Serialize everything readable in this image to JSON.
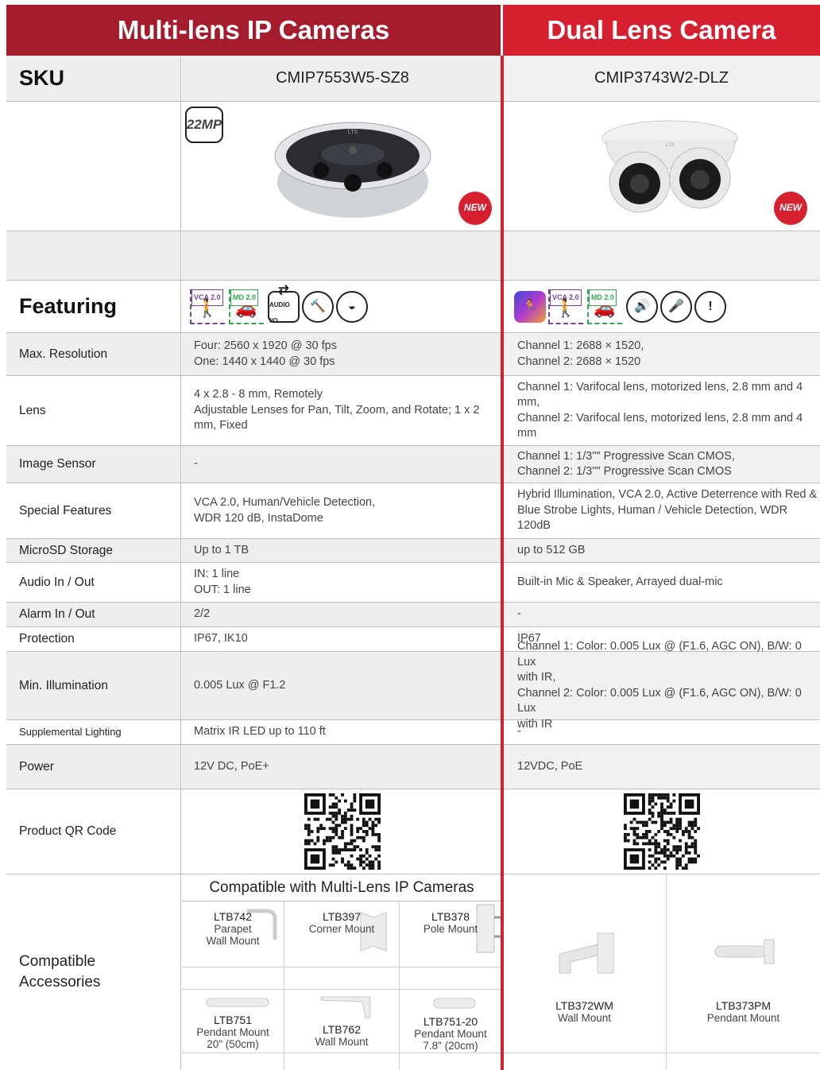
{
  "header": {
    "left_title": "Multi-lens IP Cameras",
    "right_title": "Dual Lens Camera"
  },
  "colors": {
    "dark_red": "#a51c2c",
    "bright_red": "#d6202f"
  },
  "sku_row": {
    "label": "SKU",
    "left": "CMIP7553W5-SZ8",
    "right": "CMIP3743W2-DLZ"
  },
  "image_row": {
    "badge_left": "22MP",
    "new_badge": "NEW"
  },
  "featuring": {
    "label": "Featuring",
    "vca": "VCA 2.0",
    "md": "MD 2.0",
    "audio_io": "AUDIO I/O"
  },
  "specs": [
    {
      "label": "Max. Resolution",
      "left": "Four: 2560 x 1920 @ 30 fps\nOne: 1440 x 1440 @ 30 fps",
      "right": "Channel 1: 2688 × 1520,\nChannel 2: 2688 × 1520"
    },
    {
      "label": "Lens",
      "left": "4 x 2.8 - 8 mm, Remotely\nAdjustable Lenses for Pan, Tilt, Zoom, and Rotate; 1 x 2\nmm, Fixed",
      "right": "Channel 1: Varifocal lens, motorized lens, 2.8 mm and 4 mm,\nChannel 2: Varifocal lens, motorized lens, 2.8 mm and 4 mm"
    },
    {
      "label": "Image Sensor",
      "left": "-",
      "right": "Channel 1: 1/3\"\" Progressive Scan CMOS,\nChannel 2: 1/3\"\" Progressive Scan CMOS"
    },
    {
      "label": "Special Features",
      "left": "VCA 2.0, Human/Vehicle Detection,\nWDR 120 dB, InstaDome",
      "right": "Hybrid Illumination, VCA 2.0, Active Deterrence with Red &\nBlue Strobe Lights, Human / Vehicle Detection, WDR 120dB"
    },
    {
      "label": "MicroSD Storage",
      "left": "Up to 1 TB",
      "right": "up to 512 GB"
    },
    {
      "label": "Audio In / Out",
      "left": "IN: 1 line\nOUT: 1 line",
      "right": "Built-in Mic & Speaker, Arrayed dual-mic"
    },
    {
      "label": "Alarm In / Out",
      "left": "2/2",
      "right": "-"
    },
    {
      "label": "Protection",
      "left": "IP67, IK10",
      "right": "IP67"
    },
    {
      "label": "Min. Illumination",
      "left": "0.005 Lux @ F1.2",
      "right": "Channel 1: Color: 0.005 Lux @ (F1.6, AGC ON), B/W: 0 Lux\nwith IR,\nChannel 2: Color: 0.005 Lux @ (F1.6, AGC ON), B/W: 0 Lux\nwith IR"
    },
    {
      "label": "Supplemental Lighting",
      "left": "Matrix IR LED up to 110 ft",
      "right": "-"
    },
    {
      "label": "Power",
      "left": "12V DC, PoE+",
      "right": "12VDC, PoE"
    }
  ],
  "qr_row": {
    "label": "Product QR Code"
  },
  "accessories": {
    "label": "Compatible\nAccessories",
    "left_title": "Compatible with Multi-Lens IP Cameras",
    "left_items": [
      {
        "sku": "LTB742",
        "desc": "Parapet\nWall Mount"
      },
      {
        "sku": "LTB397",
        "desc": "Corner Mount"
      },
      {
        "sku": "LTB378",
        "desc": "Pole Mount"
      },
      {
        "sku": "LTB751",
        "desc": "Pendant Mount\n20\" (50cm)"
      },
      {
        "sku": "LTB762",
        "desc": "Wall Mount"
      },
      {
        "sku": "LTB751-20",
        "desc": "Pendant Mount\n7.8\" (20cm)"
      }
    ],
    "right_items": [
      {
        "sku": "LTB372WM",
        "desc": "Wall Mount"
      },
      {
        "sku": "LTB373PM",
        "desc": "Pendant Mount"
      }
    ]
  }
}
